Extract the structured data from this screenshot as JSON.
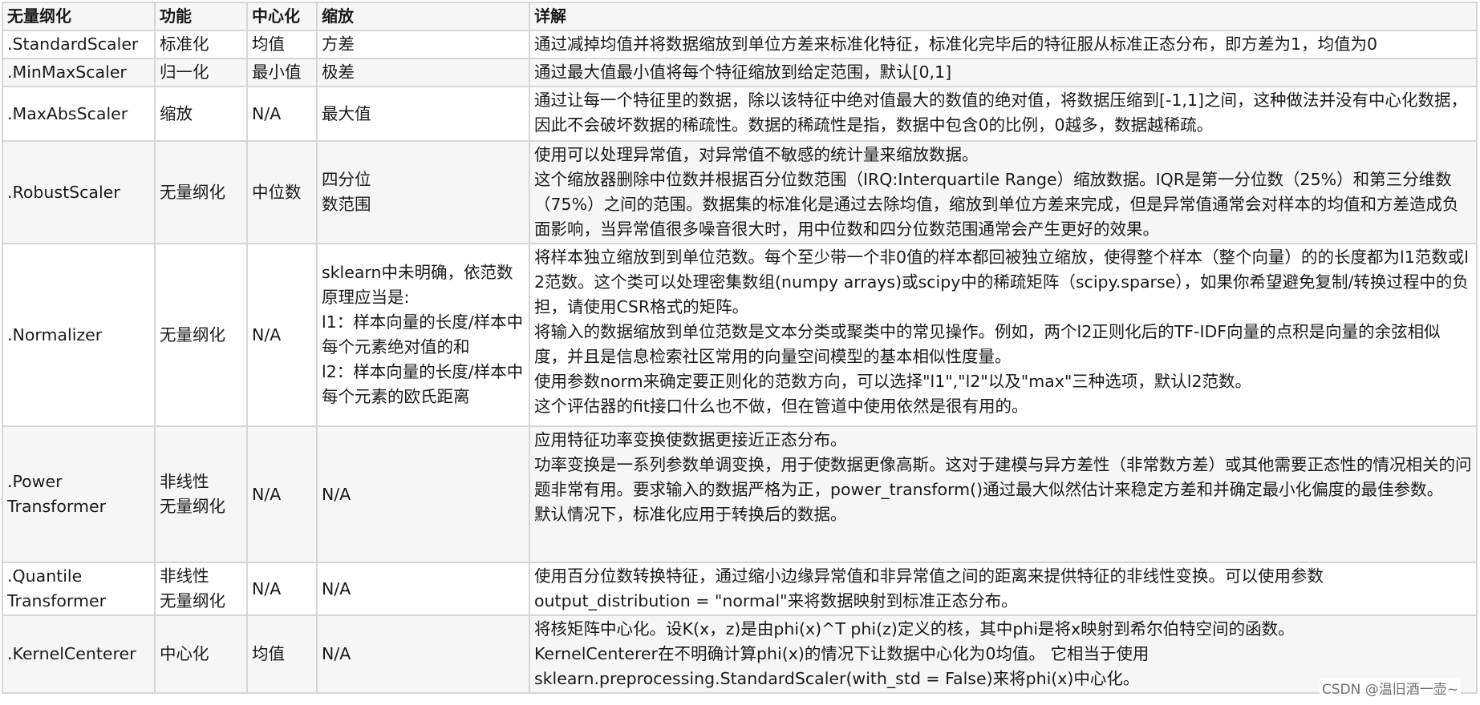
{
  "headers": [
    "无量纲化",
    "功能",
    "中心化",
    "缩放",
    "详解"
  ],
  "rows": [
    {
      "name": ".StandardScaler",
      "func": "标准化",
      "center": "均值",
      "scale": "方差",
      "detail": [
        "通过减掉均值并将数据缩放到单位方差来标准化特征，标准化完毕后的特征服从标准正态分布，即方差为1，均值为0"
      ]
    },
    {
      "name": ".MinMaxScaler",
      "func": "归一化",
      "center": "最小值",
      "scale": "极差",
      "detail": [
        "通过最大值最小值将每个特征缩放到给定范围，默认[0,1]"
      ]
    },
    {
      "name": ".MaxAbsScaler",
      "func": "缩放",
      "center": "N/A",
      "scale": "最大值",
      "detail": [
        "通过让每一个特征里的数据，除以该特征中绝对值最大的数值的绝对值，将数据压缩到[-1,1]之间，这种做法并没有中心化数据，因此不会破坏数据的稀疏性。数据的稀疏性是指，数据中包含0的比例，0越多，数据越稀疏。"
      ]
    },
    {
      "name": ".RobustScaler",
      "func": "无量纲化",
      "center": "中位数",
      "scale": "四分位\n数范围",
      "detail": [
        "使用可以处理异常值，对异常值不敏感的统计量来缩放数据。",
        "这个缩放器删除中位数并根据百分位数范围（IRQ:Interquartile Range）缩放数据。IQR是第一分位数（25%）和第三分维数（75%）之间的范围。数据集的标准化是通过去除均值，缩放到单位方差来完成，但是异常值通常会对样本的均值和方差造成负面影响，当异常值很多噪音很大时，用中位数和四分位数范围通常会产生更好的效果。"
      ]
    },
    {
      "name": ".Normalizer",
      "func": "无量纲化",
      "center": "N/A",
      "scale": "sklearn中未明确，依范数原理应当是:\nl1：样本向量的长度/样本中每个元素绝对值的和\nl2：样本向量的长度/样本中每个元素的欧氏距离",
      "detail": [
        "将样本独立缩放到到单位范数。每个至少带一个非0值的样本都回被独立缩放，使得整个样本（整个向量）的的长度都为l1范数或l2范数。这个类可以处理密集数组(numpy arrays)或scipy中的稀疏矩阵（scipy.sparse），如果你希望避免复制/转换过程中的负担，请使用CSR格式的矩阵。",
        "将输入的数据缩放到单位范数是文本分类或聚类中的常见操作。例如，两个l2正则化后的TF-IDF向量的点积是向量的余弦相似度，并且是信息检索社区常用的向量空间模型的基本相似性度量。",
        "使用参数norm来确定要正则化的范数方向，可以选择\"l1\",\"l2\"以及\"max\"三种选项，默认l2范数。",
        "这个评估器的fit接口什么也不做，但在管道中使用依然是很有用的。"
      ]
    },
    {
      "name": ".Power\nTransformer",
      "func": "非线性\n无量纲化",
      "center": "N/A",
      "scale": "N/A",
      "detail": [
        "应用特征功率变换使数据更接近正态分布。",
        "功率变换是一系列参数单调变换，用于使数据更像高斯。这对于建模与异方差性（非常数方差）或其他需要正态性的情况相关的问题非常有用。要求输入的数据严格为正，power_transform()通过最大似然估计来稳定方差和并确定最小化偏度的最佳参数。",
        "默认情况下，标准化应用于转换后的数据。"
      ]
    },
    {
      "name": ".Quantile\nTransformer",
      "func": "非线性\n无量纲化",
      "center": "N/A",
      "scale": "N/A",
      "detail": [
        "使用百分位数转换特征，通过缩小边缘异常值和非异常值之间的距离来提供特征的非线性变换。可以使用参数",
        "output_distribution = \"normal\"来将数据映射到标准正态分布。"
      ]
    },
    {
      "name": ".KernelCenterer",
      "func": "中心化",
      "center": "均值",
      "scale": "N/A",
      "detail": [
        "将核矩阵中心化。设K(x，z)是由phi(x)^T phi(z)定义的核，其中phi是将x映射到希尔伯特空间的函数。",
        "KernelCenterer在不明确计算phi(x)的情况下让数据中心化为0均值。 它相当于使用",
        "sklearn.preprocessing.StandardScaler(with_std = False)来将phi(x)中心化。"
      ]
    }
  ],
  "watermark": "CSDN @温旧酒一壶~"
}
